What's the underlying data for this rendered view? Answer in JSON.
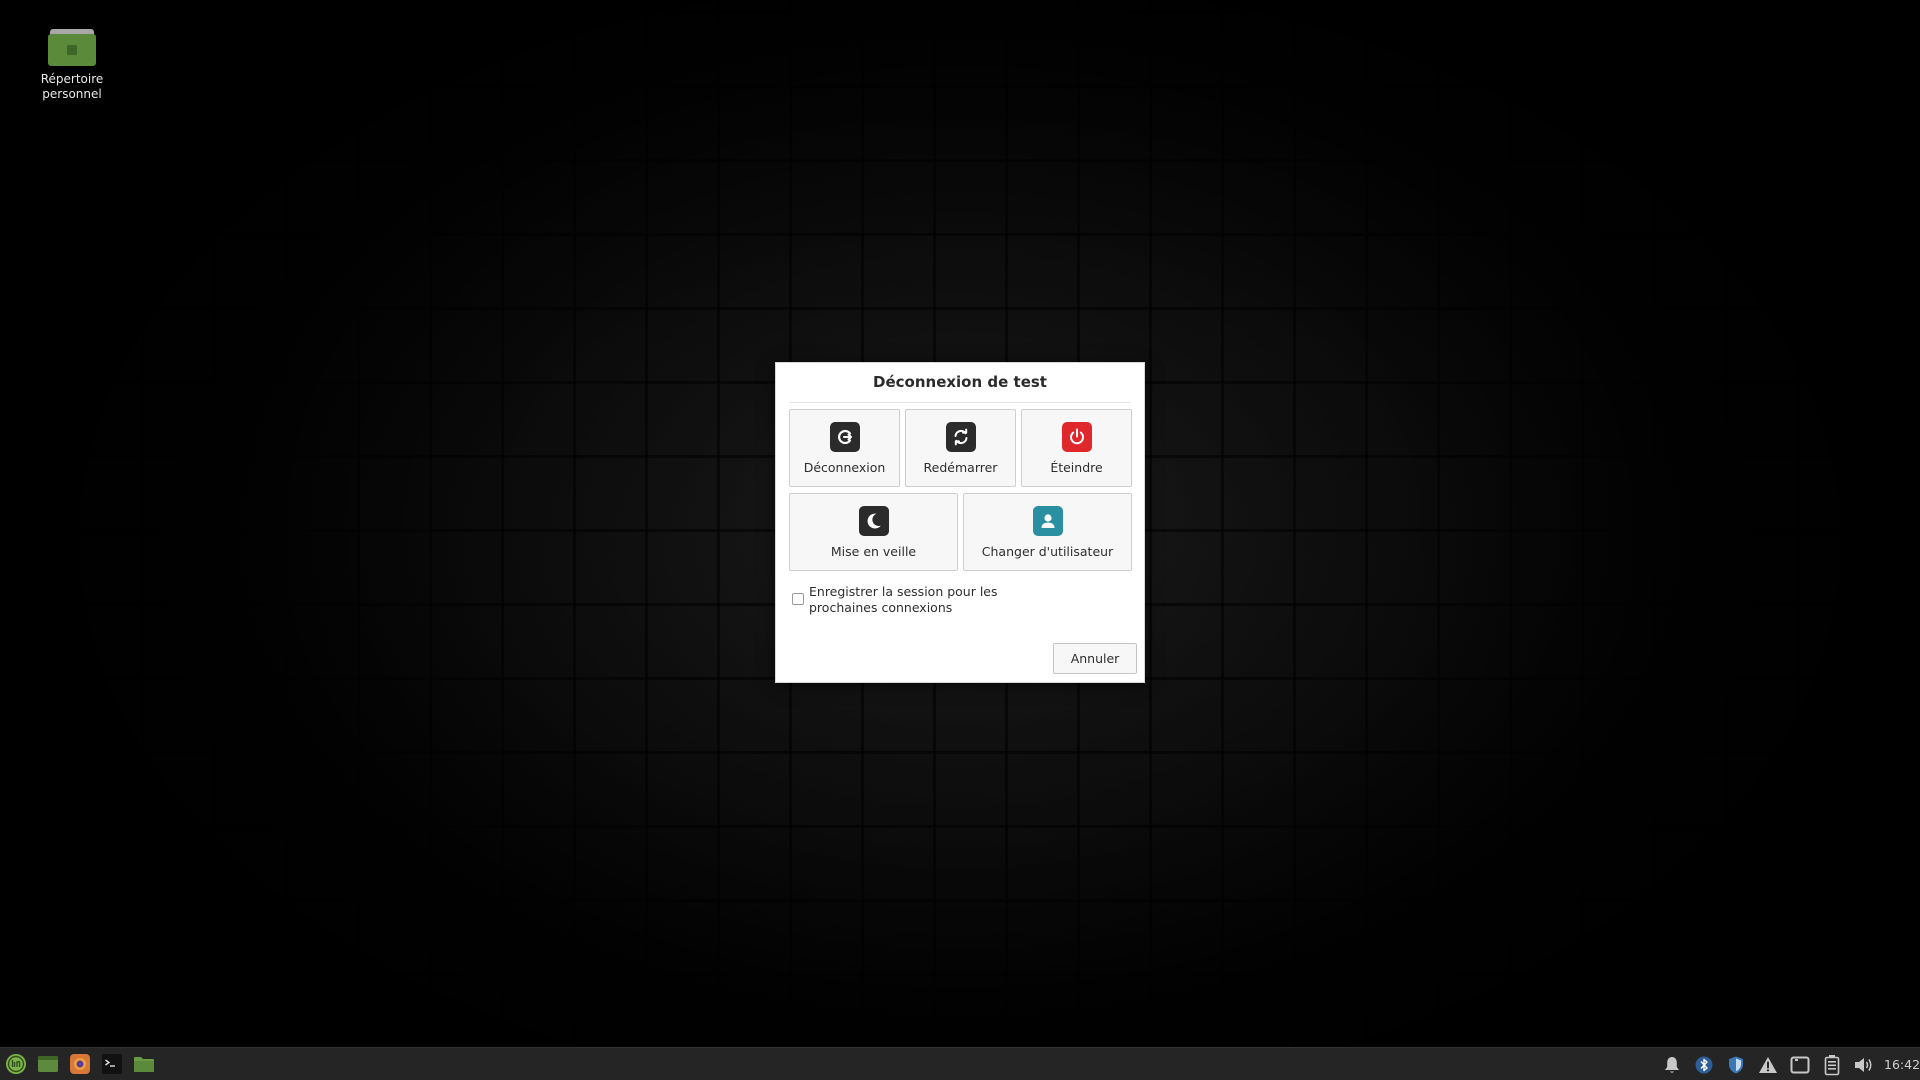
{
  "desktop": {
    "icons": [
      {
        "label_line1": "Répertoire",
        "label_line2": "personnel",
        "icon": "home-folder-icon"
      }
    ]
  },
  "dialog": {
    "title": "Déconnexion de test",
    "actions": [
      {
        "label": "Déconnexion",
        "icon": "logout-icon",
        "color": "#2b2b2b"
      },
      {
        "label": "Redémarrer",
        "icon": "restart-icon",
        "color": "#2b2b2b"
      },
      {
        "label": "Éteindre",
        "icon": "power-icon",
        "color": "#e0282c"
      },
      {
        "label": "Mise en veille",
        "icon": "moon-icon",
        "color": "#2b2b2b"
      },
      {
        "label": "Changer d'utilisateur",
        "icon": "user-icon",
        "color": "#2a8fa0"
      }
    ],
    "save_session_label": "Enregistrer la session pour les prochaines connexions",
    "save_session_checked": false,
    "cancel_label": "Annuler"
  },
  "taskbar": {
    "launchers": [
      {
        "name": "menu",
        "icon": "mint-menu-icon"
      },
      {
        "name": "show-desktop",
        "icon": "show-desktop-icon"
      },
      {
        "name": "firefox",
        "icon": "firefox-icon"
      },
      {
        "name": "terminal",
        "icon": "terminal-icon"
      },
      {
        "name": "files",
        "icon": "folder-icon"
      }
    ],
    "tray": [
      {
        "name": "notifications",
        "icon": "bell-icon"
      },
      {
        "name": "bluetooth",
        "icon": "bluetooth-icon"
      },
      {
        "name": "update-manager",
        "icon": "shield-icon"
      },
      {
        "name": "warning",
        "icon": "warning-icon"
      },
      {
        "name": "network",
        "icon": "network-icon"
      },
      {
        "name": "battery",
        "icon": "battery-icon"
      },
      {
        "name": "volume",
        "icon": "volume-icon"
      }
    ],
    "clock": "16:42"
  }
}
